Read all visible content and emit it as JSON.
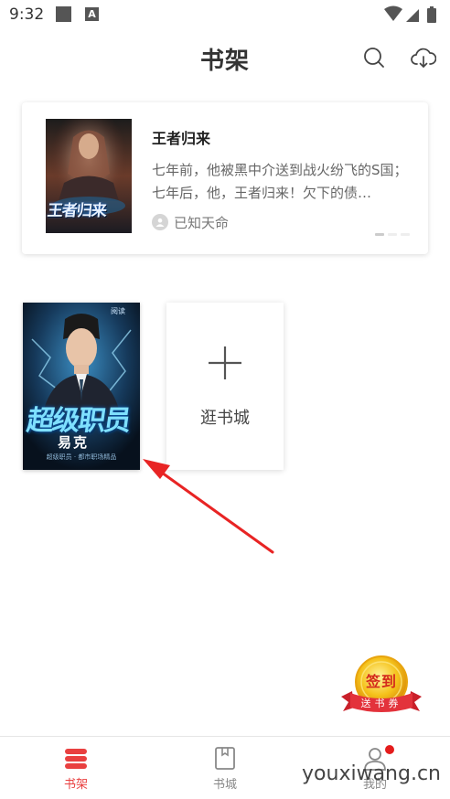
{
  "status_bar": {
    "time": "9:32",
    "notif_letter": "A"
  },
  "header": {
    "title": "书架",
    "search_icon": "search-icon",
    "download_icon": "cloud-download-icon"
  },
  "recommend": {
    "title": "王者归来",
    "description": "七年前，他被黑中介送到战火纷飞的S国；七年后，他，王者归来！欠下的债…",
    "author": "已知天命",
    "cover_text": "王者归来"
  },
  "shelf": {
    "book": {
      "cover_title": "超级职员",
      "cover_author": "易克",
      "cover_tagline": "超级职员 · 都市职场精品",
      "cover_publisher": "阅读"
    },
    "add_label": "逛书城"
  },
  "checkin": {
    "top": "签到",
    "bottom": "送书券"
  },
  "bottom_nav": {
    "items": [
      {
        "label": "书架",
        "icon": "bookshelf-icon",
        "active": true
      },
      {
        "label": "书城",
        "icon": "bookstore-icon",
        "active": false
      },
      {
        "label": "我的",
        "icon": "profile-icon",
        "active": false
      }
    ]
  },
  "watermark": "youxiwang.cn",
  "colors": {
    "accent": "#e94040",
    "arrow": "#e82424",
    "badge": "#e41c1c",
    "gold": "#f2b514"
  }
}
